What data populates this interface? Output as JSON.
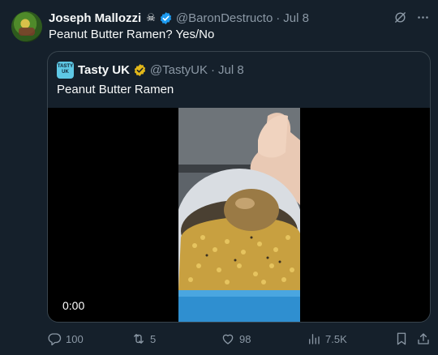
{
  "tweet": {
    "author_name": "Joseph Mallozzi",
    "author_emoji": "☠",
    "handle": "@BaronDestructo",
    "separator": "·",
    "date": "Jul 8",
    "text": "Peanut Butter Ramen?  Yes/No"
  },
  "quote": {
    "avatar_text_top": "TASTY",
    "avatar_text_bottom": "UK",
    "author_name": "Tasty UK",
    "handle": "@TastyUK",
    "separator": "·",
    "date": "Jul 8",
    "text": "Peanut Butter Ramen",
    "video_time": "0:00"
  },
  "actions": {
    "replies": "100",
    "retweets": "5",
    "likes": "98",
    "views": "7.5K"
  },
  "colors": {
    "background": "#15202b",
    "text": "#f7f9f9",
    "muted": "#8b98a5",
    "verified_blue": "#1d9bf0",
    "verified_gold": "#e2b719",
    "border": "#38444d"
  },
  "icons": {
    "grok": "grok-icon",
    "more": "more-icon",
    "reply": "reply-icon",
    "retweet": "retweet-icon",
    "like": "heart-icon",
    "views": "views-icon",
    "bookmark": "bookmark-icon",
    "share": "share-icon"
  }
}
